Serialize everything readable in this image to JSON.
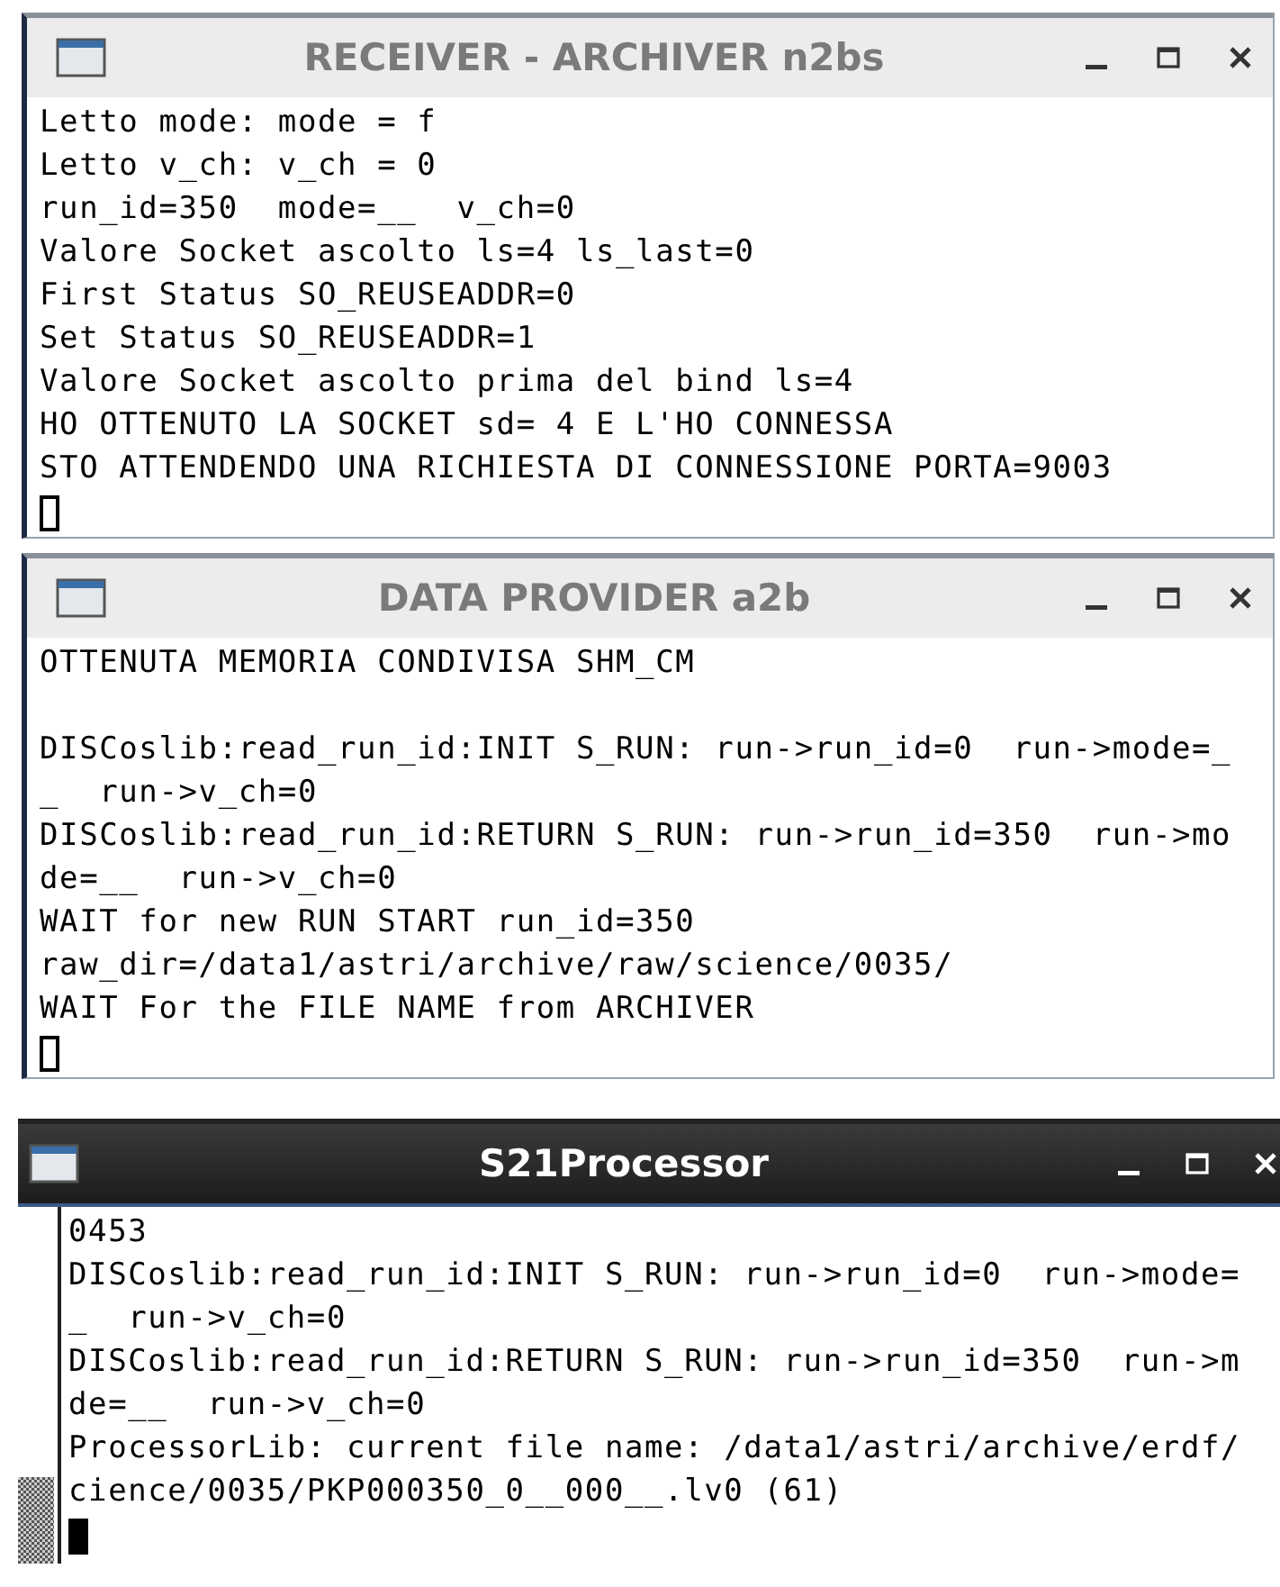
{
  "windows": [
    {
      "title": "RECEIVER - ARCHIVER n2bs",
      "kind": "light",
      "cursor_filled": false,
      "lines": [
        {
          "text": "Letto mode: mode = f"
        },
        {
          "text": "Letto v_ch: v_ch = 0"
        },
        {
          "text": "run_id=350  mode=__  v_ch=0"
        },
        {
          "text": "Valore Socket ascolto ls=4 ls_last=0"
        },
        {
          "text": "First Status SO_REUSEADDR=0"
        },
        {
          "text": "Set Status SO_REUSEADDR=1"
        },
        {
          "text": "Valore Socket ascolto prima del bind ls=4"
        },
        {
          "text": "HO OTTENUTO LA SOCKET sd= 4 E L'HO CONNESSA"
        },
        {
          "text": "STO ATTENDENDO UNA RICHIESTA DI CONNESSIONE PORTA=9003"
        }
      ]
    },
    {
      "title": "DATA PROVIDER a2b",
      "kind": "light",
      "cursor_filled": false,
      "lines": [
        {
          "text": "OTTENUTA MEMORIA CONDIVISA SHM_CM",
          "gap_after": true
        },
        {
          "text": "DISCoslib:read_run_id:INIT S_RUN: run->run_id=0  run->mode=_"
        },
        {
          "text": "_  run->v_ch=0"
        },
        {
          "text": "DISCoslib:read_run_id:RETURN S_RUN: run->run_id=350  run->mo"
        },
        {
          "text": "de=__  run->v_ch=0"
        },
        {
          "text": "WAIT for new RUN START run_id=350"
        },
        {
          "text": "raw_dir=/data1/astri/archive/raw/science/0035/"
        },
        {
          "text": "WAIT For the FILE NAME from ARCHIVER"
        }
      ]
    },
    {
      "title": "S21Processor",
      "kind": "dark",
      "cursor_filled": true,
      "lines": [
        {
          "text": "0453"
        },
        {
          "text": "DISCoslib:read_run_id:INIT S_RUN: run->run_id=0  run->mode="
        },
        {
          "text": "_  run->v_ch=0"
        },
        {
          "text": "DISCoslib:read_run_id:RETURN S_RUN: run->run_id=350  run->m"
        },
        {
          "text": "de=__  run->v_ch=0"
        },
        {
          "text": "ProcessorLib: current file name: /data1/astri/archive/erdf/"
        },
        {
          "text": "cience/0035/PKP000350_0__000__.lv0 (61)"
        }
      ]
    }
  ]
}
